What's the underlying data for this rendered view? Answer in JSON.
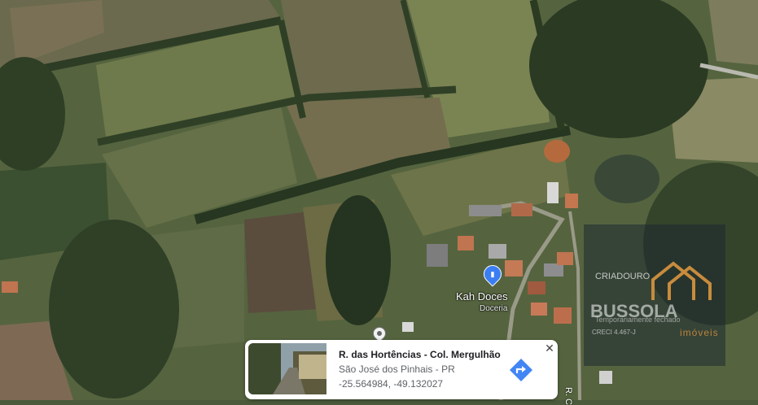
{
  "map": {
    "view": "satellite",
    "poi": {
      "name": "Kah Doces",
      "category": "Doceria",
      "icon": "shopping-bag-icon",
      "color": "#3b7ef3"
    },
    "street_label": "R. C",
    "location_pin_icon": "location-pin-icon"
  },
  "watermark": {
    "line1": "CRIADOURO",
    "brand": "BUSSOLA",
    "sub": "Temporariamente fechado",
    "creci": "CRECI 4.467-J",
    "imoveis": "imóveis",
    "accent": "#c88c3c"
  },
  "card": {
    "title": "R. das Hortências - Col. Mergulhão",
    "address": "São José dos Pinhais - PR",
    "coords": "-25.564984, -49.132027",
    "close_icon": "close-icon",
    "directions_icon": "directions-icon",
    "accent": "#4285f4"
  }
}
